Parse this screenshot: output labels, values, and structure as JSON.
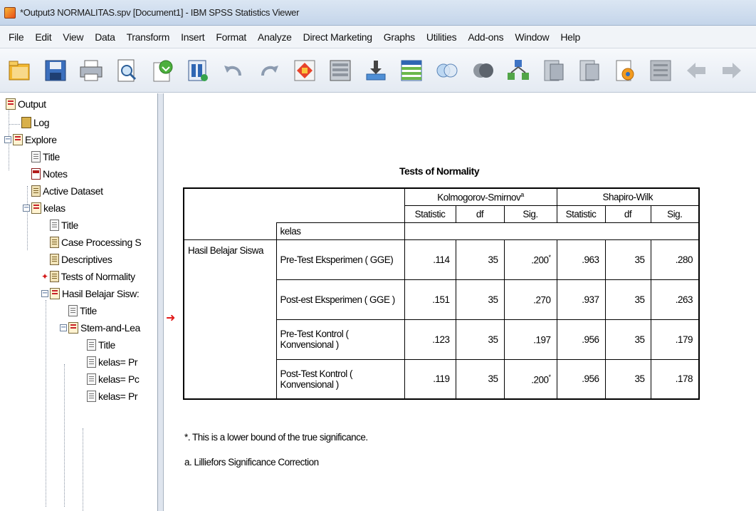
{
  "window": {
    "title": "*Output3 NORMALITAS.spv [Document1] - IBM SPSS Statistics Viewer"
  },
  "menu": [
    {
      "label": "File"
    },
    {
      "label": "Edit"
    },
    {
      "label": "View"
    },
    {
      "label": "Data"
    },
    {
      "label": "Transform"
    },
    {
      "label": "Insert"
    },
    {
      "label": "Format"
    },
    {
      "label": "Analyze"
    },
    {
      "label": "Direct Marketing"
    },
    {
      "label": "Graphs"
    },
    {
      "label": "Utilities"
    },
    {
      "label": "Add-ons"
    },
    {
      "label": "Window"
    },
    {
      "label": "Help"
    }
  ],
  "outline": {
    "output": "Output",
    "log": "Log",
    "explore": "Explore",
    "title1": "Title",
    "notes": "Notes",
    "active_dataset": "Active Dataset",
    "kelas": "kelas",
    "title2": "Title",
    "case_processing": "Case Processing S",
    "descriptives": "Descriptives",
    "tests_of_normality": "Tests of Normality",
    "hasil": "Hasil Belajar Sisw:",
    "title3": "Title",
    "stem_leaf": "Stem-and-Lea",
    "title4": "Title",
    "kelas_pr": "kelas= Pr",
    "kelas_po": "kelas= Pc",
    "kelas_pr2": "kelas= Pr"
  },
  "table": {
    "title": "Tests of Normality",
    "group_ks": "Kolmogorov-Smirnov",
    "group_ks_sup": "a",
    "group_sw": "Shapiro-Wilk",
    "col_kelas": "kelas",
    "col_statistic": "Statistic",
    "col_df": "df",
    "col_sig": "Sig.",
    "row_group": "Hasil Belajar Siswa",
    "rows": [
      {
        "kelas": "Pre-Test Eksperimen ( GGE)",
        "ks_stat": ".114",
        "ks_df": "35",
        "ks_sig": ".200",
        "ks_sig_sup": "*",
        "sw_stat": ".963",
        "sw_df": "35",
        "sw_sig": ".280"
      },
      {
        "kelas": "Post-est Eksperimen ( GGE )",
        "ks_stat": ".151",
        "ks_df": "35",
        "ks_sig": ".270",
        "ks_sig_sup": "",
        "sw_stat": ".937",
        "sw_df": "35",
        "sw_sig": ".263"
      },
      {
        "kelas": "Pre-Test Kontrol ( Konvensional )",
        "ks_stat": ".123",
        "ks_df": "35",
        "ks_sig": ".197",
        "ks_sig_sup": "",
        "sw_stat": ".956",
        "sw_df": "35",
        "sw_sig": ".179"
      },
      {
        "kelas": "Post-Test Kontrol ( Konvensional )",
        "ks_stat": ".119",
        "ks_df": "35",
        "ks_sig": ".200",
        "ks_sig_sup": "*",
        "sw_stat": ".956",
        "sw_df": "35",
        "sw_sig": ".178"
      }
    ],
    "footnote_star": "*. This is a lower bound of the true significance.",
    "footnote_a": "a. Lilliefors Significance Correction"
  }
}
